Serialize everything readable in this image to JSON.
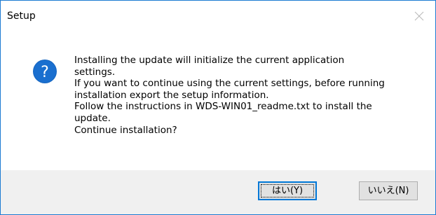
{
  "window": {
    "title": "Setup"
  },
  "message": {
    "lines": [
      " Installing the update will initialize the current application",
      "settings.",
      "If you want to continue using the current settings, before running",
      "installation export the setup information.",
      "Follow the instructions in WDS-WIN01_readme.txt to install the",
      "update.",
      "Continue installation?"
    ]
  },
  "buttons": {
    "yes_label": "はい(Y)",
    "no_label": "いいえ(N)"
  },
  "colors": {
    "window_border": "#1c7bd2",
    "icon_fill": "#1565c0",
    "footer_background": "#f0f0f0",
    "default_button_border": "#0078d7"
  },
  "icons": {
    "dialog_icon": "question-icon",
    "close": "close-icon"
  }
}
